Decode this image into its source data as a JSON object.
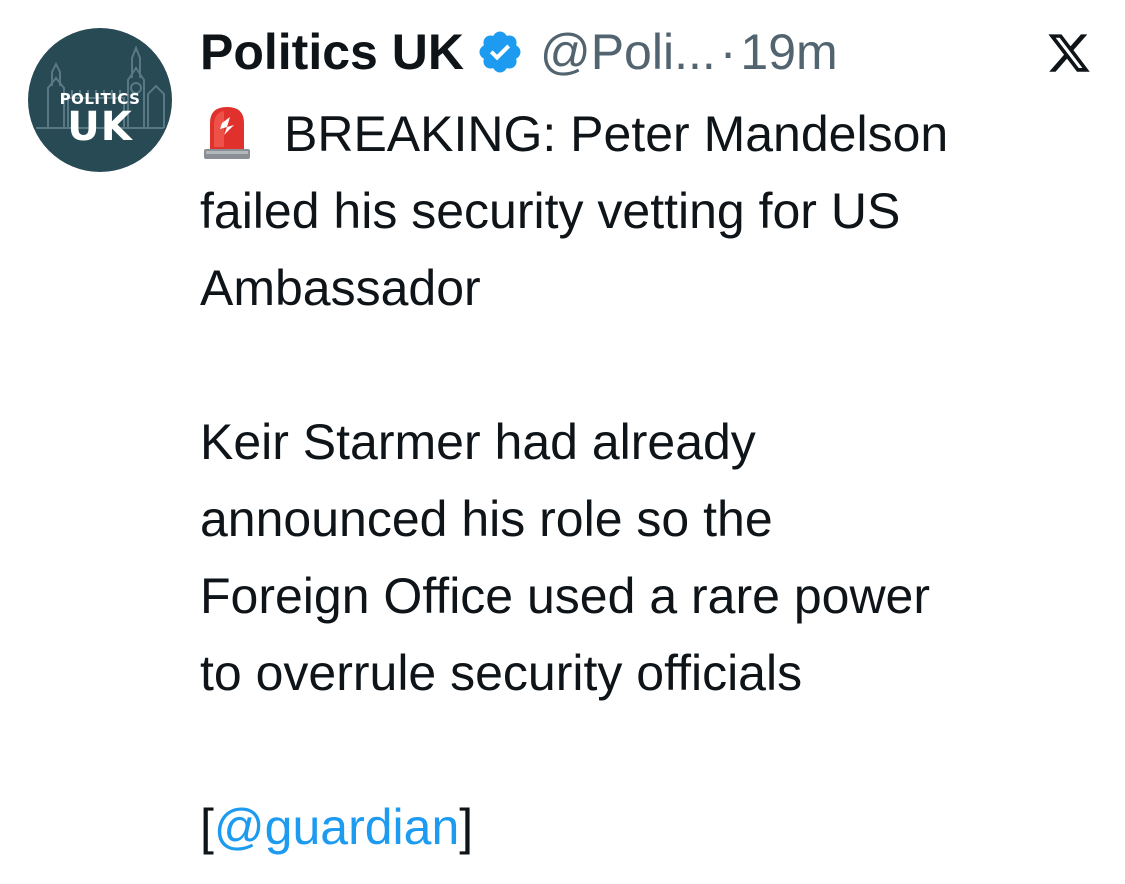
{
  "tweet": {
    "author": {
      "display_name": "Politics UK",
      "handle": "@Poli...",
      "avatar_text_small": "POLITICS",
      "avatar_text_big": "UK",
      "verified": true
    },
    "separator": "·",
    "time": "19m",
    "platform_icon": "x-logo-icon",
    "body": {
      "line1": "BREAKING: Peter Mandelson",
      "line2": "failed his security vetting for US",
      "line3": "Ambassador",
      "line4": "Keir Starmer had already",
      "line5": "announced his role so the",
      "line6": "Foreign Office used a rare power",
      "line7": "to overrule security officials",
      "bracket_open": "[",
      "mention": "@guardian",
      "bracket_close": "]"
    },
    "icons": {
      "siren": "police-light-emoji-icon",
      "verified": "verified-badge-icon"
    }
  },
  "colors": {
    "text": "#0f1419",
    "secondary": "#536471",
    "link": "#1d9bf0",
    "verified": "#1d9bf0",
    "avatar_bg": "#274a55"
  }
}
